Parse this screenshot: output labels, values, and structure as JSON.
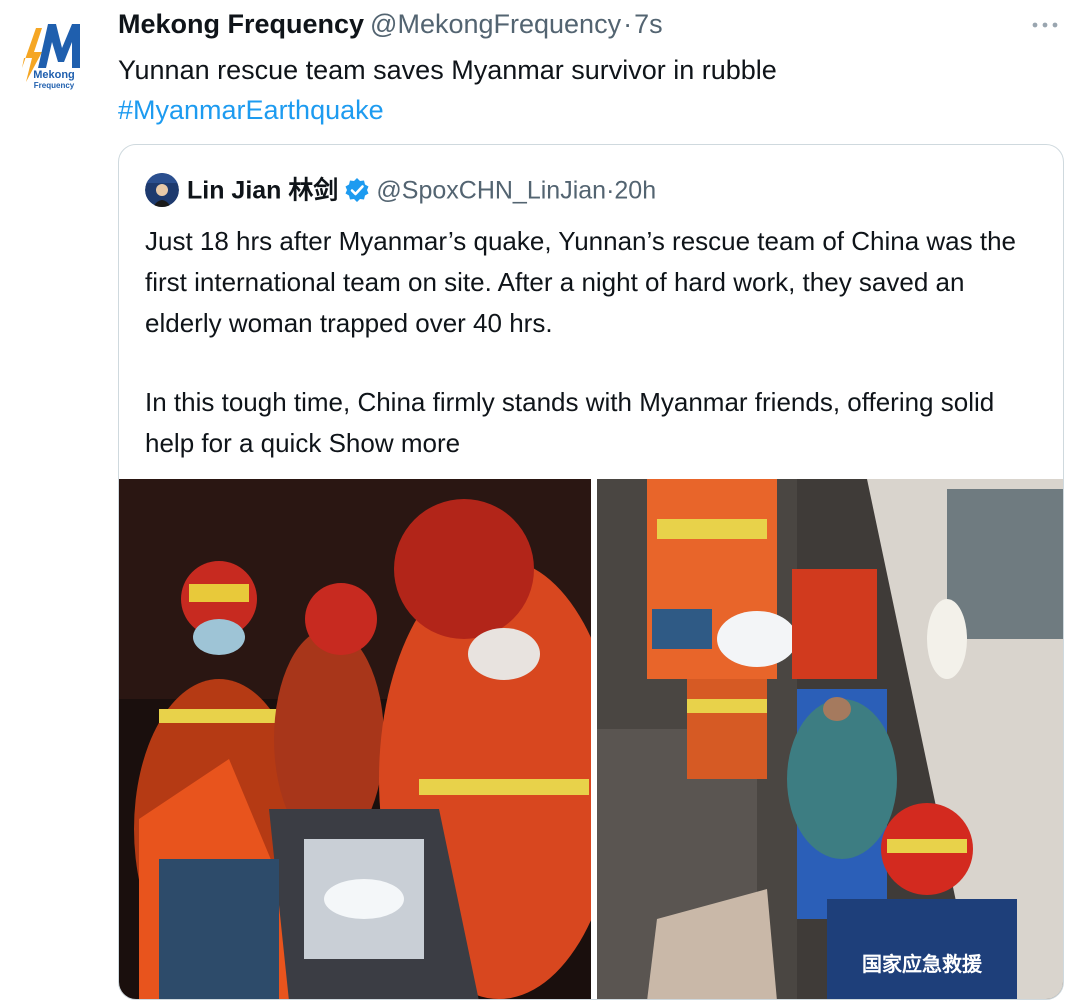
{
  "author": {
    "display_name": "Mekong Frequency",
    "handle": "@MekongFrequency",
    "separator": "·",
    "timestamp": "7s",
    "avatar_label_line1": "Mekong",
    "avatar_label_line2": "Frequency",
    "avatar_icon": "mekong-frequency-logo"
  },
  "tweet": {
    "text": "Yunnan rescue team saves Myanmar survivor in rubble",
    "hashtag": "#MyanmarEarthquake",
    "more_icon": "more-options-icon"
  },
  "quoted_tweet": {
    "display_name": "Lin Jian 林剑",
    "verified_icon": "verified-badge-icon",
    "handle": "@SpoxCHN_LinJian",
    "separator": "·",
    "timestamp": "20h",
    "paragraph1": "Just 18 hrs after Myanmar’s quake, Yunnan’s rescue team of China was the first international team on site. After a night of hard work, they saved an elderly woman trapped over 40 hrs.",
    "paragraph2": "In this tough time, China firmly stands with Myanmar friends, offering solid help for a quick",
    "show_more": "Show more",
    "jacket_text": "国家应急救援"
  },
  "colors": {
    "link": "#1d9bf0",
    "secondary_text": "#536471",
    "border": "#cfd9de",
    "verified": "#1d9bf0",
    "rescue_orange": "#e8541d"
  }
}
